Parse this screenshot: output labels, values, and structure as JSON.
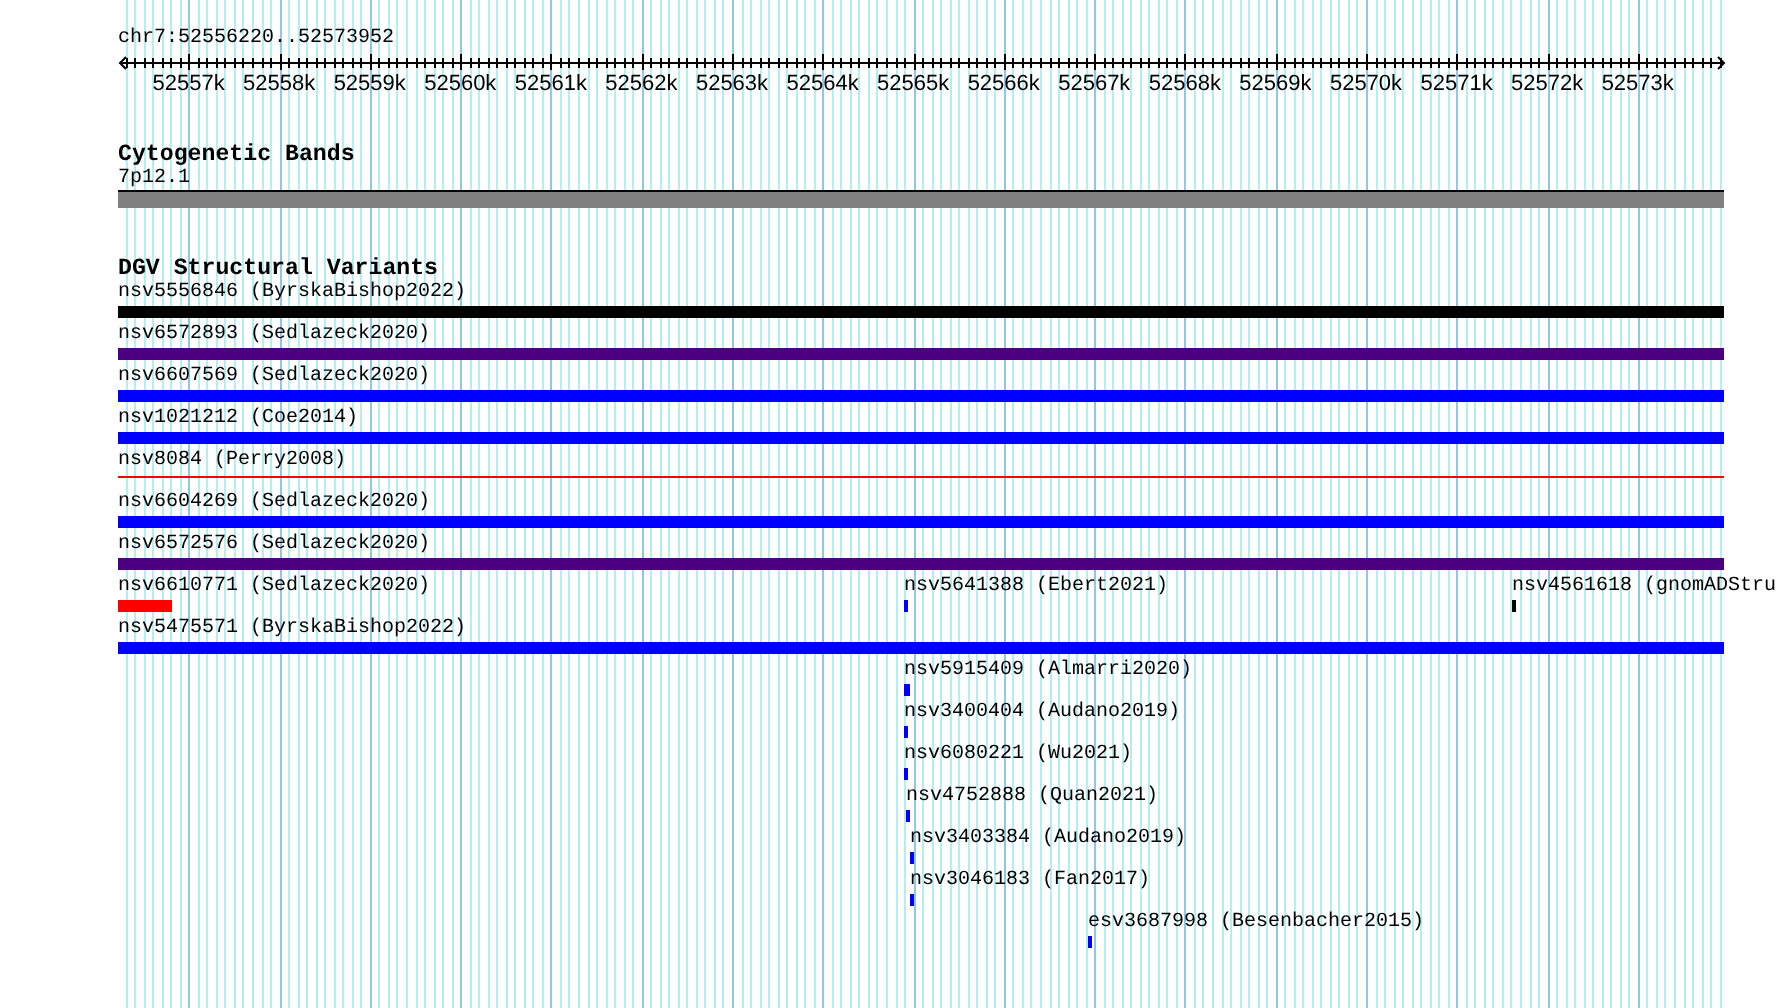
{
  "ruler": {
    "location": "chr7:52556220..52573952",
    "ticks": [
      "52557k",
      "52558k",
      "52559k",
      "52560k",
      "52561k",
      "52562k",
      "52563k",
      "52564k",
      "52565k",
      "52566k",
      "52567k",
      "52568k",
      "52569k",
      "52570k",
      "52571k",
      "52572k",
      "52573k"
    ]
  },
  "tracks": [
    {
      "title": "Cytogenetic Bands",
      "kind": "bands",
      "lanes": [
        [
          {
            "label": "7p12.1",
            "kind": "band",
            "color": "#808080"
          }
        ]
      ]
    },
    {
      "title": "DGV Structural Variants",
      "kind": "variants",
      "lanes": [
        [
          {
            "label": "nsv5556846 (ByrskaBishop2022)",
            "kind": "bar",
            "color": "#000000"
          }
        ],
        [
          {
            "label": "nsv6572893 (Sedlazeck2020)",
            "kind": "bar",
            "color": "#4b0082"
          }
        ],
        [
          {
            "label": "nsv6607569 (Sedlazeck2020)",
            "kind": "bar",
            "color": "#0000ff"
          }
        ],
        [
          {
            "label": "nsv1021212 (Coe2014)",
            "kind": "bar",
            "color": "#0000ff"
          }
        ],
        [
          {
            "label": "nsv8084 (Perry2008)",
            "kind": "line",
            "color": "#ff0000"
          }
        ],
        [
          {
            "label": "nsv6604269 (Sedlazeck2020)",
            "kind": "bar",
            "color": "#0000ff"
          }
        ],
        [
          {
            "label": "nsv6572576 (Sedlazeck2020)",
            "kind": "bar",
            "color": "#4b0082"
          }
        ],
        [
          {
            "label": "nsv6610771 (Sedlazeck2020)",
            "kind": "bar",
            "color": "#ff0000"
          },
          {
            "label": "nsv5641388 (Ebert2021)",
            "kind": "bar",
            "color": "#0000ff"
          },
          {
            "label": "nsv4561618 (gnomADStru",
            "kind": "bar",
            "color": "#000000"
          }
        ],
        [
          {
            "label": "nsv5475571 (ByrskaBishop2022)",
            "kind": "bar",
            "color": "#0000ff"
          }
        ],
        [
          {
            "label": "nsv5915409 (Almarri2020)",
            "kind": "bar",
            "color": "#0000ff"
          }
        ],
        [
          {
            "label": "nsv3400404 (Audano2019)",
            "kind": "bar",
            "color": "#0000ff"
          }
        ],
        [
          {
            "label": "nsv6080221 (Wu2021)",
            "kind": "bar",
            "color": "#0000ff"
          }
        ],
        [
          {
            "label": "nsv4752888 (Quan2021)",
            "kind": "bar",
            "color": "#0000ff"
          }
        ],
        [
          {
            "label": "nsv3403384 (Audano2019)",
            "kind": "bar",
            "color": "#0000ff"
          }
        ],
        [
          {
            "label": "nsv3046183 (Fan2017)",
            "kind": "bar",
            "color": "#0000ff"
          }
        ],
        [
          {
            "label": "esv3687998 (Besenbacher2015)",
            "kind": "bar",
            "color": "#0000ff"
          }
        ]
      ]
    }
  ]
}
